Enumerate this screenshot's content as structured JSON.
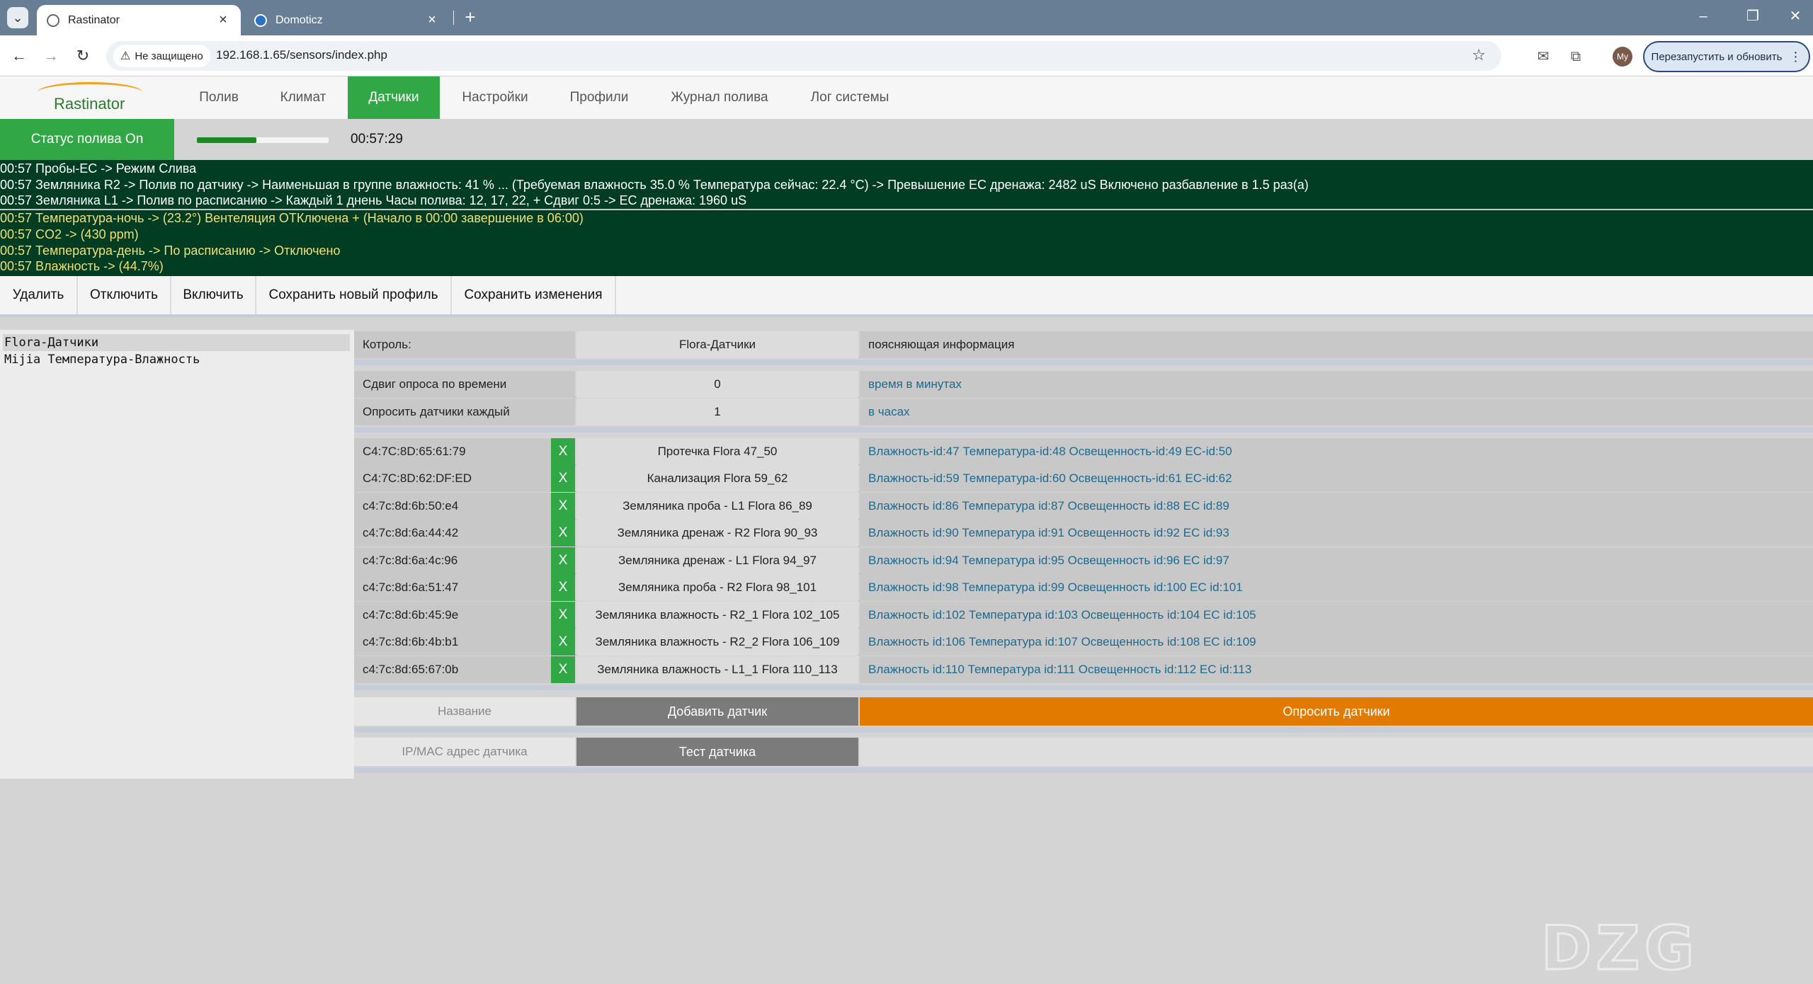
{
  "browser": {
    "tabs": [
      {
        "title": "Rastinator",
        "active": true
      },
      {
        "title": "Domoticz",
        "active": false
      }
    ],
    "security_label": "Не защищено",
    "url": "192.168.1.65/sensors/index.php",
    "profile_initials": "My",
    "restart_label": "Перезапустить и обновить"
  },
  "app": {
    "logo_text": "Rastinator",
    "nav": [
      "Полив",
      "Климат",
      "Датчики",
      "Настройки",
      "Профили",
      "Журнал полива",
      "Лог системы"
    ],
    "active_nav": "Датчики"
  },
  "status": {
    "label": "Статус полива On",
    "progress": 0.45,
    "time": "00:57:29"
  },
  "log": [
    {
      "text": "00:57 Пробы-EC -> Режим Слива",
      "color": "white"
    },
    {
      "text": "00:57 Земляника R2 -> Полив по датчику -> Наименьшая в группе влажность: 41 % ... (Требуемая влажность 35.0 % Температура сейчас: 22.4 °C) -> Превышение EC дренажа: 2482 uS Включено разбавление в 1.5 раз(а)",
      "color": "white"
    },
    {
      "text": "00:57 Земляника L1 -> Полив по расписанию -> Каждый 1 днень Часы полива: 12, 17, 22, + Сдвиг 0:5 -> EC дренажа: 1960 uS",
      "color": "white"
    },
    {
      "text": "00:57 Температура-ночь -> (23.2°) Вентеляция ОТКлючена + (Начало в 00:00 завершение в 06:00)",
      "color": "yellow"
    },
    {
      "text": "00:57 CO2 -> (430 ppm)",
      "color": "yellow"
    },
    {
      "text": "00:57 Температура-день -> По расписанию -> Отключено",
      "color": "yellow"
    },
    {
      "text": "00:57 Влажность -> (44.7%)",
      "color": "yellow"
    }
  ],
  "actions": [
    "Удалить",
    "Отключить",
    "Включить",
    "Сохранить новый профиль",
    "Сохранить изменения"
  ],
  "profiles": [
    {
      "name": "Flora-Датчики",
      "selected": true
    },
    {
      "name": "Mijia Температура-Влажность",
      "selected": false
    }
  ],
  "settings_header": {
    "label": "Котроль:",
    "value": "Flora-Датчики",
    "info": "поясняющая информация"
  },
  "settings": [
    {
      "label": "Сдвиг опроса по времени",
      "value": "0",
      "info": "время в минутах"
    },
    {
      "label": "Опросить датчики каждый",
      "value": "1",
      "info": "в часах"
    }
  ],
  "sensors": [
    {
      "mac": "C4:7C:8D:65:61:79",
      "x": "X",
      "name": "Протечка Flora 47_50",
      "ids": "Влажность-id:47 Температура-id:48 Освещенность-id:49 EC-id:50"
    },
    {
      "mac": "C4:7C:8D:62:DF:ED",
      "x": "X",
      "name": "Канализация Flora 59_62",
      "ids": "Влажность-id:59 Температура-id:60 Освещенность-id:61 EC-id:62"
    },
    {
      "mac": "c4:7c:8d:6b:50:e4",
      "x": "X",
      "name": "Земляника проба - L1 Flora 86_89",
      "ids": "Влажность id:86 Температура id:87 Освещенность id:88 EC id:89"
    },
    {
      "mac": "c4:7c:8d:6a:44:42",
      "x": "X",
      "name": "Земляника дренаж - R2 Flora 90_93",
      "ids": "Влажность id:90 Температура id:91 Освещенность id:92 EC id:93"
    },
    {
      "mac": "c4:7c:8d:6a:4c:96",
      "x": "X",
      "name": "Земляника дренаж - L1 Flora 94_97",
      "ids": "Влажность id:94 Температура id:95 Освещенность id:96 EC id:97"
    },
    {
      "mac": "c4:7c:8d:6a:51:47",
      "x": "X",
      "name": "Земляника проба - R2 Flora 98_101",
      "ids": "Влажность id:98 Температура id:99 Освещенность id:100 EC id:101"
    },
    {
      "mac": "c4:7c:8d:6b:45:9e",
      "x": "X",
      "name": "Земляника влажность - R2_1 Flora 102_105",
      "ids": "Влажность id:102 Температура id:103 Освещенность id:104 EC id:105"
    },
    {
      "mac": "c4:7c:8d:6b:4b:b1",
      "x": "X",
      "name": "Земляника влажность - R2_2 Flora 106_109",
      "ids": "Влажность id:106 Температура id:107 Освещенность id:108 EC id:109"
    },
    {
      "mac": "c4:7c:8d:65:67:0b",
      "x": "X",
      "name": "Земляника влажность - L1_1 Flora 110_113",
      "ids": "Влажность id:110 Температура id:111 Освещенность id:112 EC id:113"
    }
  ],
  "form": {
    "name_placeholder": "Название",
    "add_label": "Добавить датчик",
    "poll_label": "Опросить датчики",
    "address_placeholder": "IP/MAC адрес датчика",
    "test_label": "Тест датчика"
  },
  "colors": {
    "accent_green": "#31a745",
    "log_background": "#003d22",
    "log_yellow": "#f2df7a",
    "poll_orange": "#e27a00",
    "info_blue": "#1e6a8f"
  }
}
